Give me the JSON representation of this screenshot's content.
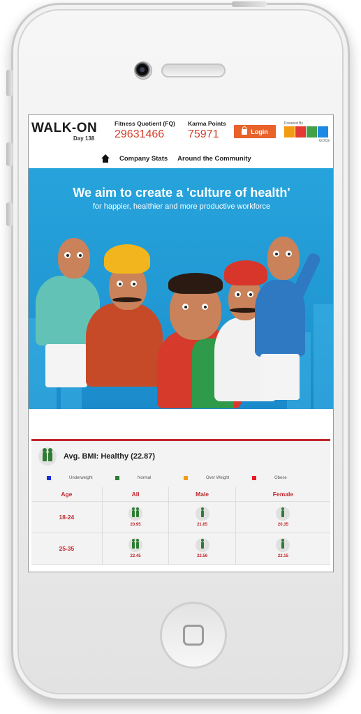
{
  "header": {
    "logo": "WALK-ON",
    "day": "Day 138",
    "fq_label": "Fitness Quotient (FQ)",
    "fq_value": "29631466",
    "kp_label": "Karma Points",
    "kp_value": "75971",
    "login_label": "Login",
    "powered_by": "Powered By",
    "powered_brand": "GOQii"
  },
  "nav": {
    "items": [
      "Company Stats",
      "Around the Community"
    ]
  },
  "hero": {
    "title": "We aim to create a 'culture of health'",
    "subtitle": "for happier, healthier and more productive workforce"
  },
  "bmi": {
    "title": "Avg. BMI: Healthy (22.87)",
    "legend": [
      {
        "label": "Underweight",
        "color": "#1a2fd6"
      },
      {
        "label": "Normal",
        "color": "#2e7d32"
      },
      {
        "label": "Over Weight",
        "color": "#f39c12"
      },
      {
        "label": "Obese",
        "color": "#e51c23"
      }
    ],
    "columns": [
      "Age",
      "All",
      "Male",
      "Female"
    ],
    "rows": [
      {
        "age": "18-24",
        "all": "20.95",
        "male": "21.65",
        "female": "20.35"
      },
      {
        "age": "25-35",
        "all": "22.45",
        "male": "22.56",
        "female": "22.15"
      }
    ]
  },
  "colors": {
    "accent_red": "#c0272d",
    "login_orange": "#e8622a",
    "hero_blue": "#27a3dc"
  }
}
